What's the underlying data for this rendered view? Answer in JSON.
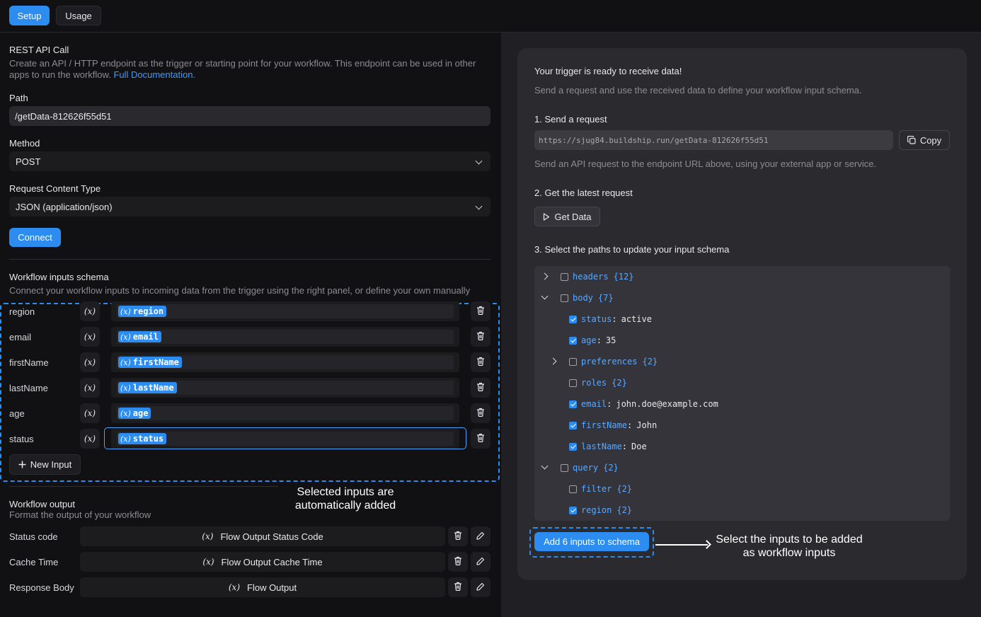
{
  "tabs": {
    "setup": "Setup",
    "usage": "Usage"
  },
  "trigger": {
    "title": "REST API Call",
    "description": "Create an API / HTTP endpoint as the trigger or starting point for your workflow. This endpoint can be used in other apps to run the workflow.",
    "doc_link": "Full Documentation."
  },
  "path": {
    "label": "Path",
    "value": "/getData-812626f55d51"
  },
  "method": {
    "label": "Method",
    "value": "POST"
  },
  "content_type": {
    "label": "Request Content Type",
    "value": "JSON (application/json)"
  },
  "connect_label": "Connect",
  "inputs_schema": {
    "title": "Workflow inputs schema",
    "description": "Connect your workflow inputs to incoming data from the trigger using the right panel, or define your own manually",
    "variable_symbol": "(x)",
    "rows": [
      {
        "name": "region",
        "chip": "region"
      },
      {
        "name": "email",
        "chip": "email"
      },
      {
        "name": "firstName",
        "chip": "firstName"
      },
      {
        "name": "lastName",
        "chip": "lastName"
      },
      {
        "name": "age",
        "chip": "age"
      },
      {
        "name": "status",
        "chip": "status"
      }
    ],
    "new_input_label": "New Input"
  },
  "annotation_left": "Selected inputs are automatically added",
  "output": {
    "title": "Workflow output",
    "description": "Format the output of your workflow",
    "rows": [
      {
        "label": "Status code",
        "value": "Flow Output Status Code"
      },
      {
        "label": "Cache Time",
        "value": "Flow Output Cache Time"
      },
      {
        "label": "Response Body",
        "value": "Flow Output"
      }
    ]
  },
  "panel": {
    "title": "Your trigger is ready to receive data!",
    "subtitle": "Send a request and use the received data to define your workflow input schema.",
    "step1": "1. Send a request",
    "url": "https://sjug84.buildship.run/getData-812626f55d51",
    "copy_label": "Copy",
    "step1_hint": "Send an API request to the endpoint URL above, using your external app or service.",
    "step2": "2. Get the latest request",
    "get_data_label": "Get Data",
    "step3": "3. Select the paths to update your input schema",
    "tree": [
      {
        "key": "headers",
        "count": "{12}",
        "checked": false,
        "caret": "right",
        "level": 0
      },
      {
        "key": "body",
        "count": "{7}",
        "checked": false,
        "caret": "down",
        "level": 0
      },
      {
        "key": "status",
        "value": "active",
        "checked": true,
        "level": 1
      },
      {
        "key": "age",
        "value": "35",
        "checked": true,
        "level": 1
      },
      {
        "key": "preferences",
        "count": "{2}",
        "checked": false,
        "caret": "right",
        "level": 1
      },
      {
        "key": "roles",
        "count": "{2}",
        "checked": false,
        "level": 1
      },
      {
        "key": "email",
        "value": "john.doe@example.com",
        "checked": true,
        "level": 1
      },
      {
        "key": "firstName",
        "value": "John",
        "checked": true,
        "level": 1
      },
      {
        "key": "lastName",
        "value": "Doe",
        "checked": true,
        "level": 1
      },
      {
        "key": "query",
        "count": "{2}",
        "checked": false,
        "caret": "down",
        "level": 0
      },
      {
        "key": "filter",
        "count": "{2}",
        "checked": false,
        "level": 1
      },
      {
        "key": "region",
        "count": "{2}",
        "checked": true,
        "level": 1
      }
    ],
    "add_button": "Add 6 inputs to schema"
  },
  "annotation_right": "Select the inputs to be added as workflow inputs",
  "colors": {
    "accent": "#2d8cf0",
    "background": "#111113",
    "panel": "#2b2b2f"
  },
  "icons": [
    "copy-icon",
    "play-icon",
    "trash-icon",
    "pencil-icon",
    "plus-icon",
    "chevron-down-icon",
    "variable-icon",
    "arrow-right-icon",
    "checkbox-icon"
  ]
}
